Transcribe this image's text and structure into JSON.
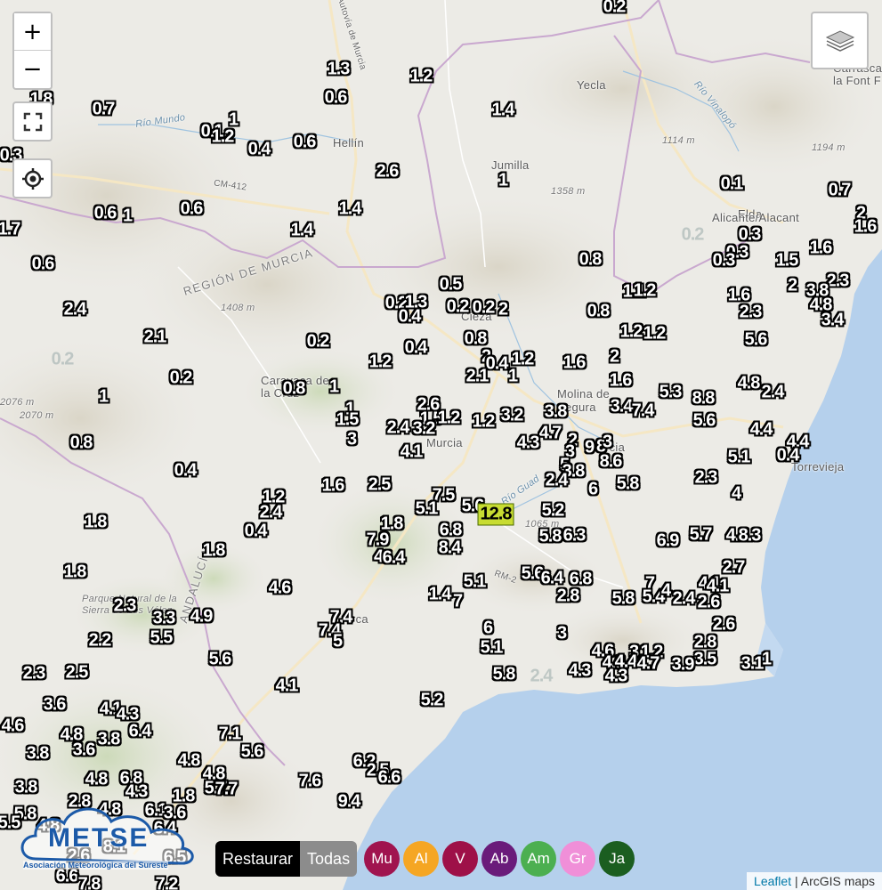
{
  "controls": {
    "zoom_in": "+",
    "zoom_out": "−"
  },
  "places": [
    {
      "key": "hellin",
      "text": "Hellín"
    },
    {
      "key": "yecla",
      "text": "Yecla"
    },
    {
      "key": "jumilla",
      "text": "Jumilla"
    },
    {
      "key": "elda",
      "text": "Elda"
    },
    {
      "key": "alicante",
      "text": "Alicante/Alacant"
    },
    {
      "key": "caravaca",
      "text": "Caravaca de la Cruz"
    },
    {
      "key": "molina",
      "text": "Molina de Segura"
    },
    {
      "key": "murcia",
      "text": "Murcia"
    },
    {
      "key": "murcia2",
      "text": "rcia"
    },
    {
      "key": "cieza",
      "text": "Cieza"
    },
    {
      "key": "torrevieja",
      "text": "Torrevieja"
    },
    {
      "key": "lorca",
      "text": "rca"
    },
    {
      "key": "carrasca",
      "text": "Carrasca la Font F"
    },
    {
      "key": "region",
      "text": "REGIÓN DE MURCIA"
    },
    {
      "key": "andalucia",
      "text": "ANDALUCÍA"
    },
    {
      "key": "parque",
      "text": "Parque Natural de la Sierra de Los Vélez"
    },
    {
      "key": "rio_mundo",
      "text": "Río Mundo"
    },
    {
      "key": "rio_vinalopo",
      "text": "Río Vinalopó"
    },
    {
      "key": "rio_guad",
      "text": "Río Guad"
    },
    {
      "key": "autovia",
      "text": "Autovía de Murcia"
    },
    {
      "key": "cm412",
      "text": "CM-412"
    },
    {
      "key": "rm2",
      "text": "RM-2"
    },
    {
      "key": "e1114",
      "text": "1114 m"
    },
    {
      "key": "e1194",
      "text": "1194 m"
    },
    {
      "key": "e1358",
      "text": "1358 m"
    },
    {
      "key": "e1408",
      "text": "1408 m"
    },
    {
      "key": "e2076",
      "text": "2076 m"
    },
    {
      "key": "e2070",
      "text": "2070 m"
    },
    {
      "key": "e1065",
      "text": "1065 m"
    }
  ],
  "precip_labels": [
    [
      "0.2",
      690,
      8,
      ""
    ],
    [
      "1.3",
      380,
      78,
      ""
    ],
    [
      "1.2",
      473,
      86,
      ""
    ],
    [
      "0.6",
      377,
      110,
      ""
    ],
    [
      "1.8",
      46,
      112,
      ""
    ],
    [
      "0.7",
      116,
      123,
      ""
    ],
    [
      "1.4",
      565,
      124,
      ""
    ],
    [
      "1",
      262,
      135,
      ""
    ],
    [
      "0.1",
      238,
      148,
      ""
    ],
    [
      "1.2",
      250,
      154,
      ""
    ],
    [
      "0.4",
      291,
      168,
      ""
    ],
    [
      "0.6",
      342,
      160,
      ""
    ],
    [
      "0.3",
      12,
      175,
      ""
    ],
    [
      "2.6",
      435,
      193,
      ""
    ],
    [
      "1",
      565,
      203,
      ""
    ],
    [
      "0.1",
      822,
      207,
      ""
    ],
    [
      "0.7",
      943,
      214,
      ""
    ],
    [
      "0.6",
      118,
      240,
      ""
    ],
    [
      "1",
      143,
      243,
      ""
    ],
    [
      "0.6",
      215,
      235,
      ""
    ],
    [
      "1.4",
      393,
      235,
      ""
    ],
    [
      "2",
      967,
      240,
      ""
    ],
    [
      "1.6",
      972,
      255,
      ""
    ],
    [
      "1.7",
      10,
      258,
      ""
    ],
    [
      "1.4",
      339,
      259,
      ""
    ],
    [
      "0.2",
      778,
      264,
      "faint"
    ],
    [
      "0.3",
      842,
      264,
      ""
    ],
    [
      "1.6",
      922,
      279,
      ""
    ],
    [
      "0.3",
      828,
      284,
      ""
    ],
    [
      "0.3",
      813,
      293,
      ""
    ],
    [
      "0.6",
      48,
      297,
      ""
    ],
    [
      "0.8",
      663,
      292,
      ""
    ],
    [
      "1.5",
      884,
      293,
      ""
    ],
    [
      "2.3",
      941,
      316,
      ""
    ],
    [
      "0.5",
      506,
      320,
      ""
    ],
    [
      "1.1",
      712,
      328,
      ""
    ],
    [
      "1.2",
      724,
      327,
      ""
    ],
    [
      "2",
      890,
      321,
      ""
    ],
    [
      "3.8",
      918,
      327,
      ""
    ],
    [
      "1.6",
      830,
      332,
      ""
    ],
    [
      "2.4",
      84,
      348,
      ""
    ],
    [
      "0.2",
      445,
      341,
      ""
    ],
    [
      "1.3",
      467,
      340,
      ""
    ],
    [
      "0.4",
      460,
      356,
      ""
    ],
    [
      "0.2",
      514,
      345,
      ""
    ],
    [
      "0.2",
      543,
      346,
      ""
    ],
    [
      "2",
      565,
      348,
      ""
    ],
    [
      "0.8",
      672,
      350,
      ""
    ],
    [
      "2.3",
      843,
      351,
      ""
    ],
    [
      "4.8",
      922,
      343,
      ""
    ],
    [
      "3.4",
      935,
      360,
      ""
    ],
    [
      "1.2",
      709,
      373,
      ""
    ],
    [
      "1.2",
      735,
      375,
      ""
    ],
    [
      "2.1",
      174,
      379,
      ""
    ],
    [
      "0.2",
      357,
      384,
      ""
    ],
    [
      "0.4",
      467,
      391,
      ""
    ],
    [
      "0.8",
      534,
      381,
      ""
    ],
    [
      "5.6",
      849,
      382,
      ""
    ],
    [
      "0.2",
      70,
      404,
      "faint"
    ],
    [
      "2",
      546,
      401,
      ""
    ],
    [
      "1.2",
      587,
      404,
      ""
    ],
    [
      "1.6",
      645,
      408,
      ""
    ],
    [
      "2",
      690,
      401,
      ""
    ],
    [
      "1.2",
      427,
      407,
      ""
    ],
    [
      "0.4",
      558,
      409,
      ""
    ],
    [
      "1",
      576,
      423,
      ""
    ],
    [
      "2.1",
      536,
      423,
      ""
    ],
    [
      "0.2",
      203,
      425,
      ""
    ],
    [
      "0.8",
      330,
      437,
      ""
    ],
    [
      "1",
      375,
      435,
      ""
    ],
    [
      "1.6",
      697,
      428,
      ""
    ],
    [
      "4.8",
      841,
      431,
      ""
    ],
    [
      "2.4",
      868,
      441,
      ""
    ],
    [
      "5.3",
      753,
      441,
      ""
    ],
    [
      "8.8",
      790,
      448,
      ""
    ],
    [
      "1",
      116,
      446,
      ""
    ],
    [
      "2.6",
      481,
      455,
      ""
    ],
    [
      "3.4",
      698,
      457,
      ""
    ],
    [
      "7.4",
      722,
      462,
      ""
    ],
    [
      "1",
      393,
      460,
      ""
    ],
    [
      "1.5",
      390,
      472,
      ""
    ],
    [
      "1.5",
      484,
      471,
      ""
    ],
    [
      "1.2",
      504,
      470,
      ""
    ],
    [
      "3.2",
      476,
      482,
      ""
    ],
    [
      "2.4",
      447,
      481,
      ""
    ],
    [
      "1.2",
      543,
      474,
      ""
    ],
    [
      "3.2",
      575,
      467,
      ""
    ],
    [
      "3.8",
      624,
      463,
      ""
    ],
    [
      "5.6",
      791,
      473,
      ""
    ],
    [
      "3",
      395,
      494,
      ""
    ],
    [
      "4.7",
      618,
      487,
      ""
    ],
    [
      "4.3",
      593,
      498,
      ""
    ],
    [
      "2",
      643,
      495,
      ""
    ],
    [
      "3",
      640,
      508,
      ""
    ],
    [
      "9",
      662,
      503,
      ""
    ],
    [
      "8",
      675,
      502,
      ""
    ],
    [
      "3",
      682,
      497,
      ""
    ],
    [
      "4.4",
      855,
      483,
      ""
    ],
    [
      "4.4",
      896,
      497,
      ""
    ],
    [
      "0.4",
      885,
      512,
      ""
    ],
    [
      "0.8",
      91,
      498,
      ""
    ],
    [
      "4.1",
      462,
      508,
      ""
    ],
    [
      "5",
      634,
      523,
      ""
    ],
    [
      "3.8",
      644,
      530,
      ""
    ],
    [
      "8.6",
      686,
      519,
      ""
    ],
    [
      "5.1",
      830,
      514,
      ""
    ],
    [
      "0.4",
      208,
      529,
      ""
    ],
    [
      "2.4",
      625,
      540,
      ""
    ],
    [
      "6",
      666,
      550,
      ""
    ],
    [
      "5.8",
      705,
      544,
      ""
    ],
    [
      "2.3",
      793,
      537,
      ""
    ],
    [
      "1.6",
      374,
      546,
      ""
    ],
    [
      "2.5",
      426,
      545,
      ""
    ],
    [
      "7.5",
      498,
      557,
      ""
    ],
    [
      "1.2",
      307,
      559,
      ""
    ],
    [
      "4",
      827,
      555,
      ""
    ],
    [
      "5.1",
      479,
      572,
      ""
    ],
    [
      "5.6",
      531,
      569,
      ""
    ],
    [
      "12.8",
      557,
      578,
      "hi"
    ],
    [
      "5.2",
      621,
      574,
      ""
    ],
    [
      "2.4",
      304,
      576,
      ""
    ],
    [
      "1.8",
      107,
      587,
      ""
    ],
    [
      "1.8",
      440,
      589,
      ""
    ],
    [
      "6.8",
      506,
      596,
      ""
    ],
    [
      "0.4",
      287,
      597,
      ""
    ],
    [
      "5.8",
      618,
      603,
      ""
    ],
    [
      "6.3",
      645,
      602,
      ""
    ],
    [
      "6.9",
      750,
      608,
      ""
    ],
    [
      "5.7",
      787,
      601,
      ""
    ],
    [
      "4.3",
      828,
      602,
      ""
    ],
    [
      "8.3",
      842,
      602,
      ""
    ],
    [
      "7.9",
      424,
      607,
      ""
    ],
    [
      "8.4",
      505,
      616,
      ""
    ],
    [
      "1.8",
      240,
      619,
      ""
    ],
    [
      "4",
      425,
      626,
      ""
    ],
    [
      "6.4",
      442,
      627,
      ""
    ],
    [
      "1.8",
      84,
      643,
      ""
    ],
    [
      "2.7",
      824,
      638,
      ""
    ],
    [
      "5.6",
      598,
      645,
      ""
    ],
    [
      "6.4",
      620,
      650,
      ""
    ],
    [
      "6.8",
      652,
      651,
      ""
    ],
    [
      "5.1",
      533,
      654,
      ""
    ],
    [
      "4.1",
      797,
      656,
      ""
    ],
    [
      "4.1",
      806,
      659,
      ""
    ],
    [
      "4.6",
      314,
      661,
      ""
    ],
    [
      "7",
      730,
      656,
      ""
    ],
    [
      "1.4",
      494,
      668,
      ""
    ],
    [
      "7",
      514,
      676,
      ""
    ],
    [
      "2.8",
      638,
      670,
      ""
    ],
    [
      "5.8",
      700,
      673,
      ""
    ],
    [
      "5.4",
      734,
      671,
      ""
    ],
    [
      "4",
      748,
      664,
      ""
    ],
    [
      "2.4",
      768,
      673,
      ""
    ],
    [
      "2.6",
      796,
      677,
      ""
    ],
    [
      "2.3",
      140,
      681,
      ""
    ],
    [
      "3.3",
      184,
      695,
      ""
    ],
    [
      "4.9",
      226,
      693,
      ""
    ],
    [
      "7.4",
      383,
      694,
      ""
    ],
    [
      "2.6",
      813,
      702,
      ""
    ],
    [
      "7.4",
      370,
      709,
      ""
    ],
    [
      "6",
      548,
      706,
      ""
    ],
    [
      "3",
      631,
      712,
      ""
    ],
    [
      "5.5",
      181,
      717,
      ""
    ],
    [
      "5",
      379,
      721,
      ""
    ],
    [
      "2.2",
      112,
      720,
      ""
    ],
    [
      "2.8",
      792,
      722,
      ""
    ],
    [
      "5.1",
      552,
      728,
      ""
    ],
    [
      "4.6",
      677,
      732,
      ""
    ],
    [
      "3",
      712,
      733,
      ""
    ],
    [
      "1.2",
      732,
      733,
      ""
    ],
    [
      "5.6",
      247,
      741,
      ""
    ],
    [
      "4.8",
      689,
      745,
      ""
    ],
    [
      "4.4",
      703,
      744,
      ""
    ],
    [
      "4.7",
      728,
      746,
      ""
    ],
    [
      "3.5",
      792,
      741,
      ""
    ],
    [
      "3.9",
      767,
      747,
      ""
    ],
    [
      "3.1",
      845,
      746,
      ""
    ],
    [
      "1",
      861,
      741,
      ""
    ],
    [
      "2.3",
      38,
      757,
      ""
    ],
    [
      "2.5",
      86,
      756,
      ""
    ],
    [
      "5.8",
      566,
      758,
      ""
    ],
    [
      "2.4",
      608,
      760,
      "faint"
    ],
    [
      "4.3",
      651,
      754,
      ""
    ],
    [
      "4.3",
      692,
      760,
      ""
    ],
    [
      "4.1",
      322,
      771,
      ""
    ],
    [
      "5.2",
      485,
      787,
      ""
    ],
    [
      "3.6",
      61,
      792,
      ""
    ],
    [
      "4.1",
      124,
      797,
      ""
    ],
    [
      "4.3",
      143,
      803,
      ""
    ],
    [
      "4.6",
      14,
      816,
      ""
    ],
    [
      "6.4",
      157,
      822,
      ""
    ],
    [
      "4.8",
      80,
      826,
      ""
    ],
    [
      "3.8",
      122,
      831,
      ""
    ],
    [
      "7.1",
      258,
      825,
      ""
    ],
    [
      "3.6",
      94,
      843,
      ""
    ],
    [
      "3.8",
      42,
      847,
      ""
    ],
    [
      "5.6",
      283,
      845,
      ""
    ],
    [
      "4.8",
      212,
      855,
      ""
    ],
    [
      "6.2",
      409,
      856,
      ""
    ],
    [
      "2.5",
      424,
      866,
      ""
    ],
    [
      "4.8",
      240,
      870,
      ""
    ],
    [
      "6.6",
      437,
      874,
      ""
    ],
    [
      "7.6",
      348,
      878,
      ""
    ],
    [
      "4.8",
      108,
      876,
      ""
    ],
    [
      "6.8",
      147,
      875,
      ""
    ],
    [
      "3.8",
      29,
      885,
      ""
    ],
    [
      "5.7",
      242,
      886,
      ""
    ],
    [
      "7.7",
      254,
      887,
      ""
    ],
    [
      "4.3",
      153,
      890,
      ""
    ],
    [
      "1.8",
      206,
      895,
      ""
    ],
    [
      "9.4",
      392,
      901,
      ""
    ],
    [
      "2.8",
      89,
      901,
      ""
    ],
    [
      "4.8",
      123,
      910,
      ""
    ],
    [
      "6.1",
      175,
      911,
      ""
    ],
    [
      "3.6",
      196,
      914,
      ""
    ],
    [
      "5.8",
      28,
      915,
      ""
    ],
    [
      "5.5",
      10,
      925,
      ""
    ],
    [
      "4.8",
      54,
      928,
      ""
    ],
    [
      "6.4",
      185,
      931,
      ""
    ],
    [
      "8.1",
      128,
      952,
      ""
    ],
    [
      "6.5",
      196,
      964,
      ""
    ],
    [
      "2.6",
      88,
      962,
      ""
    ],
    [
      "6.6",
      75,
      985,
      ""
    ],
    [
      "7.8",
      100,
      994,
      ""
    ],
    [
      "7.2",
      187,
      994,
      ""
    ]
  ],
  "brand": {
    "name": "METSE",
    "subtitle": "Asociación Meteorológica del Sureste"
  },
  "buttons": {
    "restore": "Restaurar",
    "all": "Todas"
  },
  "filters": [
    {
      "label": "Mu",
      "color": "#a0144f"
    },
    {
      "label": "Al",
      "color": "#f5a623"
    },
    {
      "label": "V",
      "color": "#9e1048"
    },
    {
      "label": "Ab",
      "color": "#6a1b7a"
    },
    {
      "label": "Am",
      "color": "#4caf50"
    },
    {
      "label": "Gr",
      "color": "#f08fd8"
    },
    {
      "label": "Ja",
      "color": "#1b5e20"
    }
  ],
  "attribution": {
    "leaflet": "Leaflet",
    "sep": " | ",
    "provider": "ArcGIS maps"
  }
}
